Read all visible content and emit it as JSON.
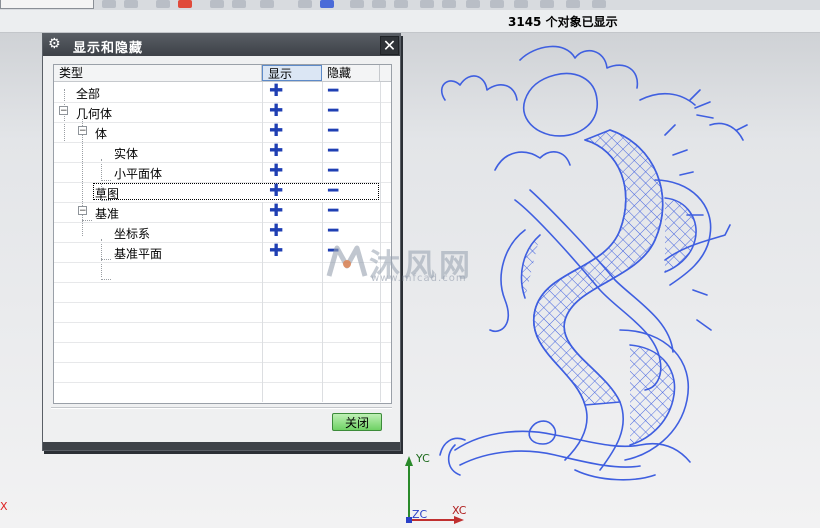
{
  "status": {
    "text": "3145 个对象已显示"
  },
  "dialog": {
    "title": "显示和隐藏",
    "columns": {
      "type": "类型",
      "show": "显示",
      "hide": "隐藏"
    },
    "rows": [
      {
        "label": "全部",
        "show": "✚",
        "hide": "━"
      },
      {
        "label": "几何体",
        "expander": "−",
        "show": "✚",
        "hide": "━"
      },
      {
        "label": "体",
        "expander": "−",
        "show": "✚",
        "hide": "━"
      },
      {
        "label": "实体",
        "show": "✚",
        "hide": "━"
      },
      {
        "label": "小平面体",
        "show": "✚",
        "hide": "━"
      },
      {
        "label": "草图",
        "show": "✚",
        "hide": "━"
      },
      {
        "label": "基准",
        "expander": "−",
        "show": "✚",
        "hide": "━"
      },
      {
        "label": "坐标系",
        "show": "✚",
        "hide": "━"
      },
      {
        "label": "基准平面",
        "show": "✚",
        "hide": "━"
      }
    ],
    "close_label": "关闭"
  },
  "watermark": {
    "text": "沐风网",
    "url": "www.mfcad.com"
  },
  "axes": {
    "y": "YC",
    "z": "ZC",
    "x": "XC"
  },
  "stray_mark": "X",
  "colors": {
    "drawing": "#3f5fe0",
    "title_bar": "#4a4f56",
    "plus_minus": "#1f3fb3"
  }
}
